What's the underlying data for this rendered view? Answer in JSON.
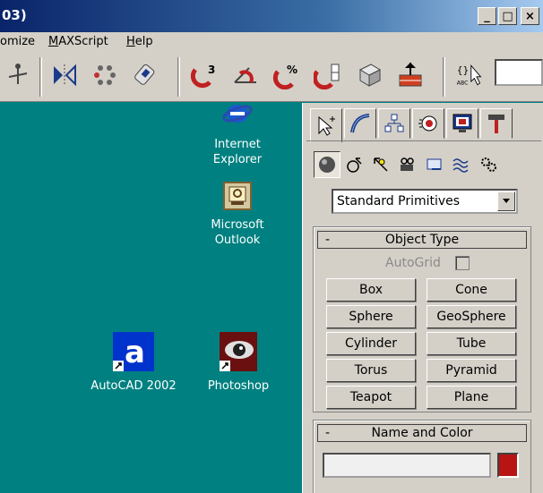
{
  "window": {
    "title": "03)",
    "minimize_label": "_",
    "maximize_label": "□",
    "close_label": "×"
  },
  "menu": {
    "items": [
      {
        "label": "omize"
      },
      {
        "label": "MAXScript"
      },
      {
        "label": "Help"
      }
    ]
  },
  "toolbar": {
    "text_icon_label": "ABC"
  },
  "desktop": {
    "icons": [
      {
        "label_line1": "Internet",
        "label_line2": "Explorer"
      },
      {
        "label_line1": "Microsoft",
        "label_line2": "Outlook"
      },
      {
        "label_line1": "AutoCAD 2002",
        "label_line2": ""
      },
      {
        "label_line1": "Photoshop",
        "label_line2": ""
      }
    ]
  },
  "command_panel": {
    "dropdown_value": "Standard Primitives",
    "object_type": {
      "header": "Object Type",
      "toggle": "-",
      "autogrid_label": "AutoGrid",
      "buttons": [
        "Box",
        "Cone",
        "Sphere",
        "GeoSphere",
        "Cylinder",
        "Tube",
        "Torus",
        "Pyramid",
        "Teapot",
        "Plane"
      ]
    },
    "name_and_color": {
      "header": "Name and Color",
      "toggle": "-",
      "name_value": "",
      "color": "#b81414"
    }
  },
  "colors": {
    "desktop": "#008080",
    "panel": "#d4d0c8",
    "title_gradient_start": "#0a246a"
  }
}
